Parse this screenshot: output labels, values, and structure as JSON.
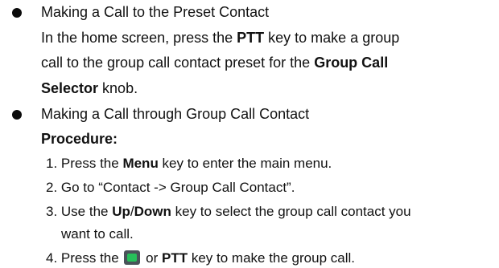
{
  "sec1": {
    "heading": "Making a Call to the Preset Contact",
    "p1a": "In the home screen, press the ",
    "p1b": "PTT",
    "p1c": " key to make a group",
    "p2a": "call to the group call contact preset for the ",
    "p2b": "Group Call",
    "p3a": "Selector",
    "p3b": " knob."
  },
  "sec2": {
    "heading": "Making a Call through Group Call Contact",
    "procedure": "Procedure:",
    "s1a": "1.  Press the ",
    "s1b": "Menu",
    "s1c": " key to enter the main menu.",
    "s2": "2.  Go to “Contact -> Group Call Contact”.",
    "s3a": "3.  Use the ",
    "s3b": "Up",
    "s3c": "/",
    "s3d": "Down",
    "s3e": " key to select the group call contact you",
    "s3f": "want to call.",
    "s4a": "4.  Press the ",
    "s4b": " or  ",
    "s4c": "PTT",
    "s4d": " key to make the group call."
  }
}
